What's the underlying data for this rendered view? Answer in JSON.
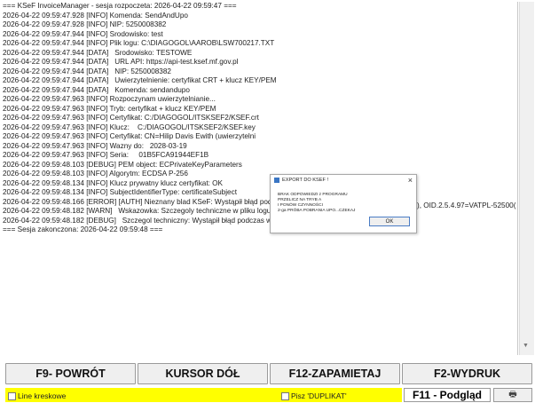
{
  "log": {
    "lines": [
      "=== KSeF InvoiceManager - sesja rozpoczeta: 2026-04-22 09:59:47 ===",
      "2026-04-22 09:59:47.928 [INFO] Komenda: SendAndUpo",
      "2026-04-22 09:59:47.928 [INFO] NIP: 5250008382",
      "2026-04-22 09:59:47.944 [INFO] Srodowisko: test",
      "2026-04-22 09:59:47.944 [INFO] Plik logu: C:\\DIAGOGOL\\AAROB\\LSW700217.TXT",
      "2026-04-22 09:59:47.944 [DATA]   Srodowisko: TESTOWE",
      "2026-04-22 09:59:47.944 [DATA]   URL API: https://api-test.ksef.mf.gov.pl",
      "2026-04-22 09:59:47.944 [DATA]   NIP: 5250008382",
      "2026-04-22 09:59:47.944 [DATA]   Uwierzytelnienie: certyfikat CRT + klucz KEY/PEM",
      "2026-04-22 09:59:47.944 [DATA]   Komenda: sendandupo",
      "2026-04-22 09:59:47.963 [INFO] Rozpoczynam uwierzytelnianie...",
      "2026-04-22 09:59:47.963 [INFO] Tryb: certyfikat + klucz KEY/PEM",
      "2026-04-22 09:59:47.963 [INFO] Certyfikat: C:/DIAGOGOL/ITSKSEF2/KSEF.crt",
      "2026-04-22 09:59:47.963 [INFO] Klucz:    C:/DIAGOGOL/ITSKSEF2/KSEF.key",
      "2026-04-22 09:59:47.963 [INFO] Certyfikat: CN=Hilip Davis Ewith (uwierzytelni",
      "2026-04-22 09:59:47.963 [INFO] Wazny do:   2028-03-19",
      "2026-04-22 09:59:47.963 [INFO] Seria:     01B5FCA91944EF1B",
      "2026-04-22 09:59:48.103 [DEBUG] PEM object: ECPrivateKeyParameters",
      "2026-04-22 09:59:48.103 [INFO] Algorytm: ECDSA P-256",
      "2026-04-22 09:59:48.134 [INFO] Klucz prywatny klucz certyfikat: OK",
      "2026-04-22 09:59:48.134 [INFO] SubjectIdentifierType: certificateSubject",
      "2026-04-22 09:59:48.166 [ERROR] [AUTH] Nieznany blad KSeF: Wystąpił błąd podczas wysyłania żądania.",
      "2026-04-22 09:59:48.182 [WARN]   Wskazowka: Szczegoly techniczne w pliku logu.",
      "2026-04-22 09:59:48.182 [DEBUG]   Szczegol techniczny: Wystąpił błąd podczas wysyłania żądania.",
      "=== Sesja zakonczona: 2026-04-22 09:59:48 ==="
    ],
    "overflow_text": "), OID.2.5.4.97=VATPL-52500("
  },
  "dialog": {
    "title": "EXPORT DO KSEF !",
    "close_glyph": "×",
    "message_lines": [
      "BRAK ODPOWIEDZI z PROGRAMU",
      "PRZELICZ NA TRYB A",
      "I PONÓW CZYNNOŚCI",
      "2-ga PRÓBA POBRANIA UPO...CZEKAJ"
    ],
    "ok_label": "OK"
  },
  "buttons": {
    "f9": "F9- POWRÓT",
    "cursor_down": "KURSOR DÓŁ",
    "f12": "F12-ZAPAMIETAJ",
    "f2": "F2-WYDRUK"
  },
  "bottom": {
    "line_checkbox": "Line kreskowe",
    "duplicate_checkbox": "Pisz 'DUPLIKAT'",
    "preview_label": "F11 - Podgląd",
    "print_icon_glyph": "🖶"
  },
  "colors": {
    "highlight": "#ffff00",
    "dialog_accent": "#3a76c4"
  }
}
